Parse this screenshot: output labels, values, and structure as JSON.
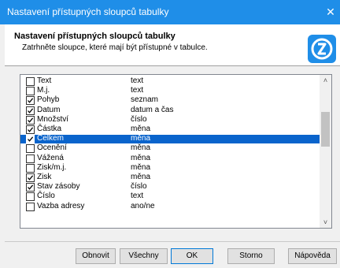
{
  "window": {
    "title": "Nastavení přístupných sloupců tabulky",
    "close_glyph": "✕"
  },
  "header": {
    "title": "Nastavení přístupných sloupců tabulky",
    "subtitle": "Zatrhněte sloupce, které mají být přístupné v tabulce.",
    "logo_icon": "logo-circle-arrow-icon",
    "accent": "#1f8ee8"
  },
  "columns": [
    {
      "name": "Text",
      "type": "text",
      "checked": false,
      "selected": false
    },
    {
      "name": "M.j.",
      "type": "text",
      "checked": false,
      "selected": false
    },
    {
      "name": "Pohyb",
      "type": "seznam",
      "checked": true,
      "selected": false
    },
    {
      "name": "Datum",
      "type": "datum a čas",
      "checked": true,
      "selected": false
    },
    {
      "name": "Množství",
      "type": "číslo",
      "checked": true,
      "selected": false
    },
    {
      "name": "Částka",
      "type": "měna",
      "checked": true,
      "selected": false
    },
    {
      "name": "Celkem",
      "type": "měna",
      "checked": true,
      "selected": true
    },
    {
      "name": "Ocenění",
      "type": "měna",
      "checked": false,
      "selected": false
    },
    {
      "name": "Vážená",
      "type": "měna",
      "checked": false,
      "selected": false
    },
    {
      "name": "Zisk/m.j.",
      "type": "měna",
      "checked": false,
      "selected": false
    },
    {
      "name": "Zisk",
      "type": "měna",
      "checked": true,
      "selected": false
    },
    {
      "name": "Stav zásoby",
      "type": "číslo",
      "checked": true,
      "selected": false
    },
    {
      "name": "Číslo",
      "type": "text",
      "checked": false,
      "selected": false
    },
    {
      "name": "Vazba adresy",
      "type": "ano/ne",
      "checked": false,
      "selected": false
    }
  ],
  "scrollbar": {
    "up_glyph": "˄",
    "down_glyph": "˅"
  },
  "buttons": {
    "refresh": "Obnovit",
    "all": "Všechny",
    "ok": "OK",
    "cancel": "Storno",
    "help": "Nápověda"
  },
  "colors": {
    "selection": "#0a64cc",
    "titlebar": "#1f8ee8"
  }
}
